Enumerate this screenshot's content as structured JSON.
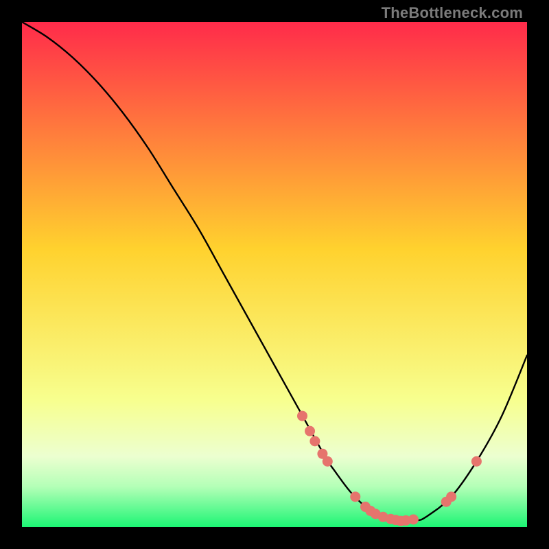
{
  "watermark": "TheBottleneck.com",
  "colors": {
    "gradient_top": "#ff2b4a",
    "gradient_mid": "#ffd22e",
    "gradient_low": "#f7ff8f",
    "gradient_band": "#ecffd0",
    "gradient_bottom": "#1cf574",
    "curve": "#000000",
    "marker": "#e6746d",
    "background": "#000000"
  },
  "chart_data": {
    "type": "line",
    "title": "",
    "xlabel": "",
    "ylabel": "",
    "xlim": [
      0,
      100
    ],
    "ylim": [
      0,
      100
    ],
    "grid": false,
    "legend": false,
    "series": [
      {
        "name": "bottleneck-curve",
        "x": [
          0,
          5,
          10,
          15,
          20,
          25,
          30,
          35,
          40,
          45,
          50,
          55,
          60,
          62,
          65,
          68,
          70,
          73,
          75,
          78,
          80,
          85,
          90,
          95,
          100
        ],
        "y": [
          100,
          97,
          93,
          88,
          82,
          75,
          67,
          59,
          50,
          41,
          32,
          23,
          14,
          11,
          7,
          4,
          2.5,
          1.5,
          1.2,
          1.3,
          2,
          6,
          13,
          22,
          34
        ]
      }
    ],
    "markers": {
      "name": "highlighted-points",
      "x": [
        55.5,
        57,
        58,
        59.5,
        60.5,
        66,
        68,
        69,
        70,
        71.5,
        73,
        74,
        75,
        76,
        77.5,
        84,
        85,
        90
      ],
      "y": [
        22,
        19,
        17,
        14.5,
        13,
        6,
        4,
        3.2,
        2.6,
        2,
        1.6,
        1.4,
        1.2,
        1.3,
        1.5,
        5,
        6,
        13
      ]
    },
    "gradient_stops_pct": [
      0,
      45,
      75,
      86,
      92,
      100
    ],
    "gradient_stop_note": "vertical gradient from red at top through yellow to green band at bottom"
  }
}
